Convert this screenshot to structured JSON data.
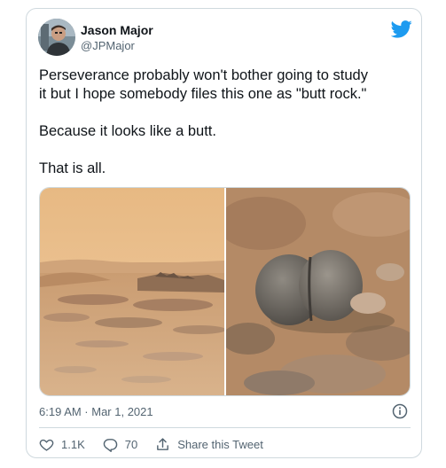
{
  "author": {
    "name": "Jason Major",
    "handle": "@JPMajor"
  },
  "tweet": {
    "paragraphs": [
      "Perseverance probably won't bother going to study\nit but I hope somebody files this one as \"butt rock.\"",
      "Because it looks like a butt.",
      "That is all."
    ]
  },
  "meta": {
    "timestamp": "6:19 AM · Mar 1, 2021"
  },
  "actions": {
    "like_count": "1.1K",
    "reply_count": "70",
    "share_label": "Share this Tweet"
  },
  "icons": {
    "brand": "twitter-bird-icon",
    "info": "info-icon",
    "like": "heart-icon",
    "reply": "reply-icon",
    "share": "share-icon"
  },
  "colors": {
    "brand": "#1d9bf0",
    "muted_text": "#536471",
    "border": "#cfd9de"
  }
}
